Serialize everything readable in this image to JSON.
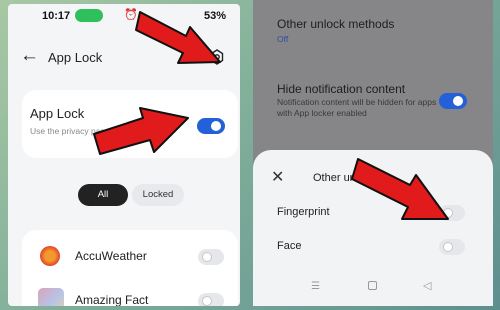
{
  "left_screen": {
    "status": {
      "time": "10:17",
      "battery_chip": "",
      "battery_pct": "53%"
    },
    "header": {
      "title": "App Lock",
      "back_icon": "back-arrow-icon",
      "search_icon": "search-icon",
      "settings_icon": "gear-icon"
    },
    "app_lock_card": {
      "title": "App Lock",
      "description": "Use the privacy passw… locked apps.",
      "toggle_on": true
    },
    "filter_tabs": [
      {
        "label": "All",
        "selected": true
      },
      {
        "label": "Locked",
        "selected": false
      }
    ],
    "apps": [
      {
        "name": "AccuWeather",
        "locked": false
      },
      {
        "name": "Amazing Fact",
        "locked": false
      }
    ]
  },
  "right_screen": {
    "other_unlock": {
      "title": "Other unlock methods",
      "value": "Off"
    },
    "hide_notification": {
      "title": "Hide notification content",
      "description": "Notification content will be hidden for apps with App locker enabled",
      "toggle_on": true
    },
    "sheet": {
      "title": "Other un…ods",
      "options": [
        {
          "label": "Fingerprint",
          "enabled": false
        },
        {
          "label": "Face",
          "enabled": false
        }
      ]
    }
  },
  "colors": {
    "accent_blue": "#2460d8",
    "arrow_red": "#e11b1b",
    "background_green": "#7fae9a"
  }
}
